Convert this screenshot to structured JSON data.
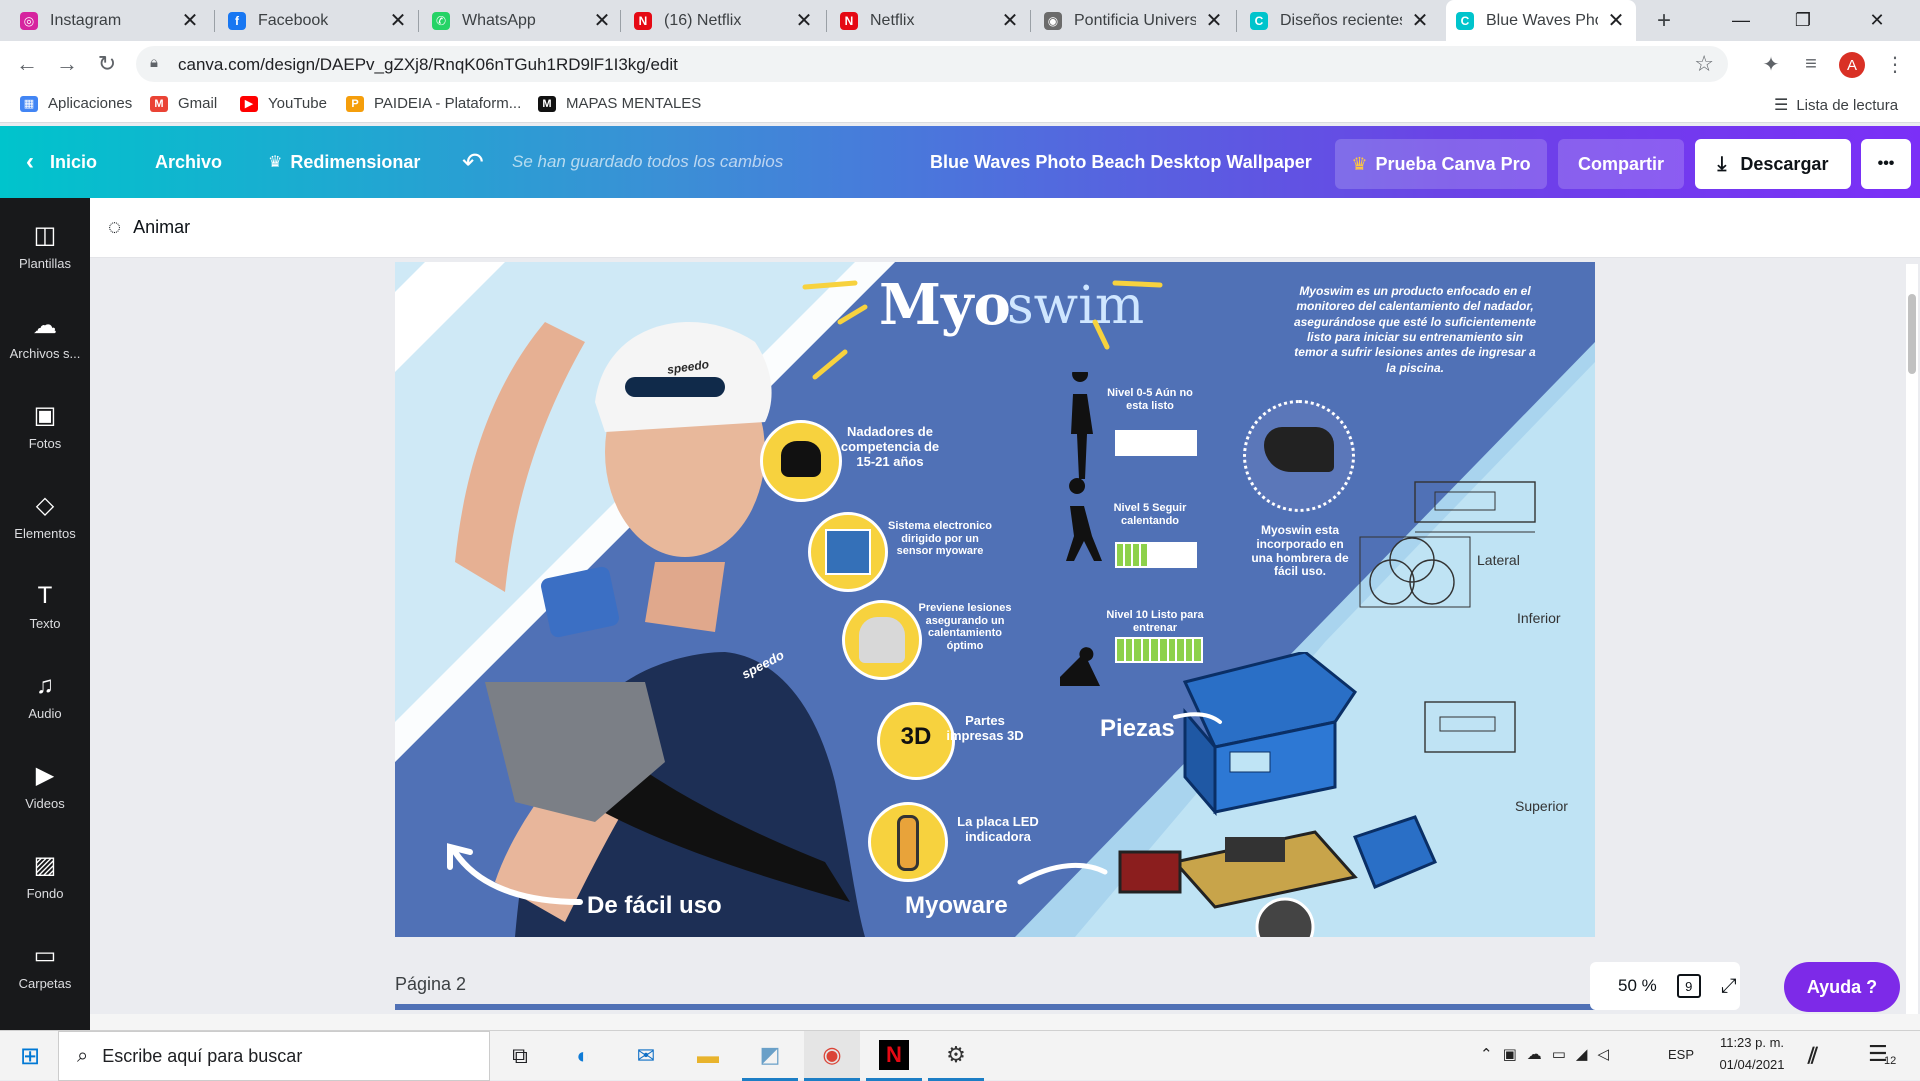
{
  "browser": {
    "tabs": [
      {
        "title": "Instagram",
        "color": "#d6249f",
        "glyph": "◎"
      },
      {
        "title": "Facebook",
        "color": "#1877f2",
        "glyph": "f"
      },
      {
        "title": "WhatsApp",
        "color": "#25d366",
        "glyph": "✆"
      },
      {
        "title": "(16) Netflix",
        "color": "#e50914",
        "glyph": "N"
      },
      {
        "title": "Netflix",
        "color": "#e50914",
        "glyph": "N"
      },
      {
        "title": "Pontificia Universid",
        "color": "#6b6b6b",
        "glyph": "◉"
      },
      {
        "title": "Diseños recientes",
        "color": "#00c4cc",
        "glyph": "C"
      },
      {
        "title": "Blue Waves Photo",
        "color": "#00c4cc",
        "glyph": "C"
      }
    ],
    "close_glyph": "✕",
    "new_tab": "+",
    "window": {
      "minimize": "—",
      "restore": "❐",
      "close": "✕"
    },
    "url": "canva.com/design/DAEPv_gZXj8/RnqK06nTGuh1RD9lF1I3kg/edit",
    "profile_initial": "A",
    "bookmarks": [
      {
        "label": "Aplicaciones",
        "color": "#4285f4",
        "glyph": "▦"
      },
      {
        "label": "Gmail",
        "color": "#ea4335",
        "glyph": "M"
      },
      {
        "label": "YouTube",
        "color": "#ff0000",
        "glyph": "▶"
      },
      {
        "label": "PAIDEIA - Plataform...",
        "color": "#f59e0b",
        "glyph": "P"
      },
      {
        "label": "MAPAS MENTALES",
        "color": "#111111",
        "glyph": "M"
      }
    ],
    "reading_list": "Lista de lectura"
  },
  "canva": {
    "home": "Inicio",
    "file": "Archivo",
    "resize": "Redimensionar",
    "saved_status": "Se han guardado todos los cambios",
    "design_title": "Blue Waves Photo Beach Desktop Wallpaper",
    "try_pro": "Prueba Canva Pro",
    "share": "Compartir",
    "download": "Descargar",
    "more": "•••",
    "animate": "Animar",
    "sidebar": [
      {
        "label": "Plantillas",
        "icon": "◫"
      },
      {
        "label": "Archivos s...",
        "icon": "☁"
      },
      {
        "label": "Fotos",
        "icon": "▣"
      },
      {
        "label": "Elementos",
        "icon": "◇"
      },
      {
        "label": "Texto",
        "icon": "T"
      },
      {
        "label": "Audio",
        "icon": "♫"
      },
      {
        "label": "Videos",
        "icon": "▶"
      },
      {
        "label": "Fondo",
        "icon": "▨"
      },
      {
        "label": "Carpetas",
        "icon": "▭"
      }
    ],
    "page_label": "Página 2",
    "zoom": "50 %",
    "page_count": "9",
    "help": "Ayuda  ?"
  },
  "design": {
    "title_a": "Myo",
    "title_b": "swim",
    "intro": "Myoswim es un producto enfocado en el monitoreo del calentamiento del nadador, asegurándose que esté lo suficientemente listo para iniciar su entrenamiento sin temor a sufrir lesiones antes de ingresar a la piscina.",
    "features": [
      "Nadadores de competencia de 15-21 años",
      "Sistema electronico dirigido por un sensor myoware",
      "Previene lesiones asegurando un calentamiento óptimo",
      "Partes impresas 3D",
      "La placa LED indicadora"
    ],
    "levels": [
      {
        "label": "Nivel 0-5 Aún no esta listo",
        "filled": 0
      },
      {
        "label": "Nivel 5 Seguir calentando",
        "filled": 4
      },
      {
        "label": "Nivel 10 Listo para entrenar",
        "filled": 10
      }
    ],
    "shoulder_text": "Myoswin esta incorporado en una hombrera de fácil uso.",
    "views": [
      "Lateral",
      "Inferior",
      "Superior"
    ],
    "pieces": "Piezas",
    "easy_use": "De fácil uso",
    "myoware": "Myoware",
    "cap_brand": "speedo",
    "suit_brand": "speedo"
  },
  "taskbar": {
    "search_placeholder": "Escribe aquí para buscar",
    "language": "ESP",
    "time": "11:23 p. m.",
    "date": "01/04/2021",
    "notifications": "12"
  }
}
